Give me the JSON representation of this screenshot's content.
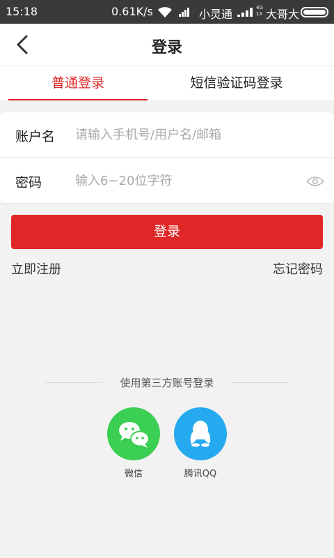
{
  "status_bar": {
    "time": "15:18",
    "speed": "0.61K/s",
    "carrier1": "小灵通",
    "network": "4G\n1X",
    "carrier2": "大哥大"
  },
  "nav": {
    "title": "登录",
    "back_icon": "chevron-left-icon"
  },
  "tabs": [
    {
      "label": "普通登录",
      "active": true
    },
    {
      "label": "短信验证码登录",
      "active": false
    }
  ],
  "form": {
    "account_label": "账户名",
    "account_placeholder": "请输入手机号/用户名/邮箱",
    "password_label": "密码",
    "password_placeholder": "输入6~20位字符",
    "eye_icon": "eye-icon"
  },
  "actions": {
    "login_label": "登录",
    "register_label": "立即注册",
    "forgot_label": "忘记密码"
  },
  "third_party": {
    "title": "使用第三方账号登录",
    "items": [
      {
        "label": "微信",
        "icon": "wechat-icon",
        "color": "#3bcf53"
      },
      {
        "label": "腾讯QQ",
        "icon": "qq-icon",
        "color": "#25a9ef"
      }
    ]
  },
  "colors": {
    "accent": "#e02626",
    "background": "#f2f2f2"
  }
}
